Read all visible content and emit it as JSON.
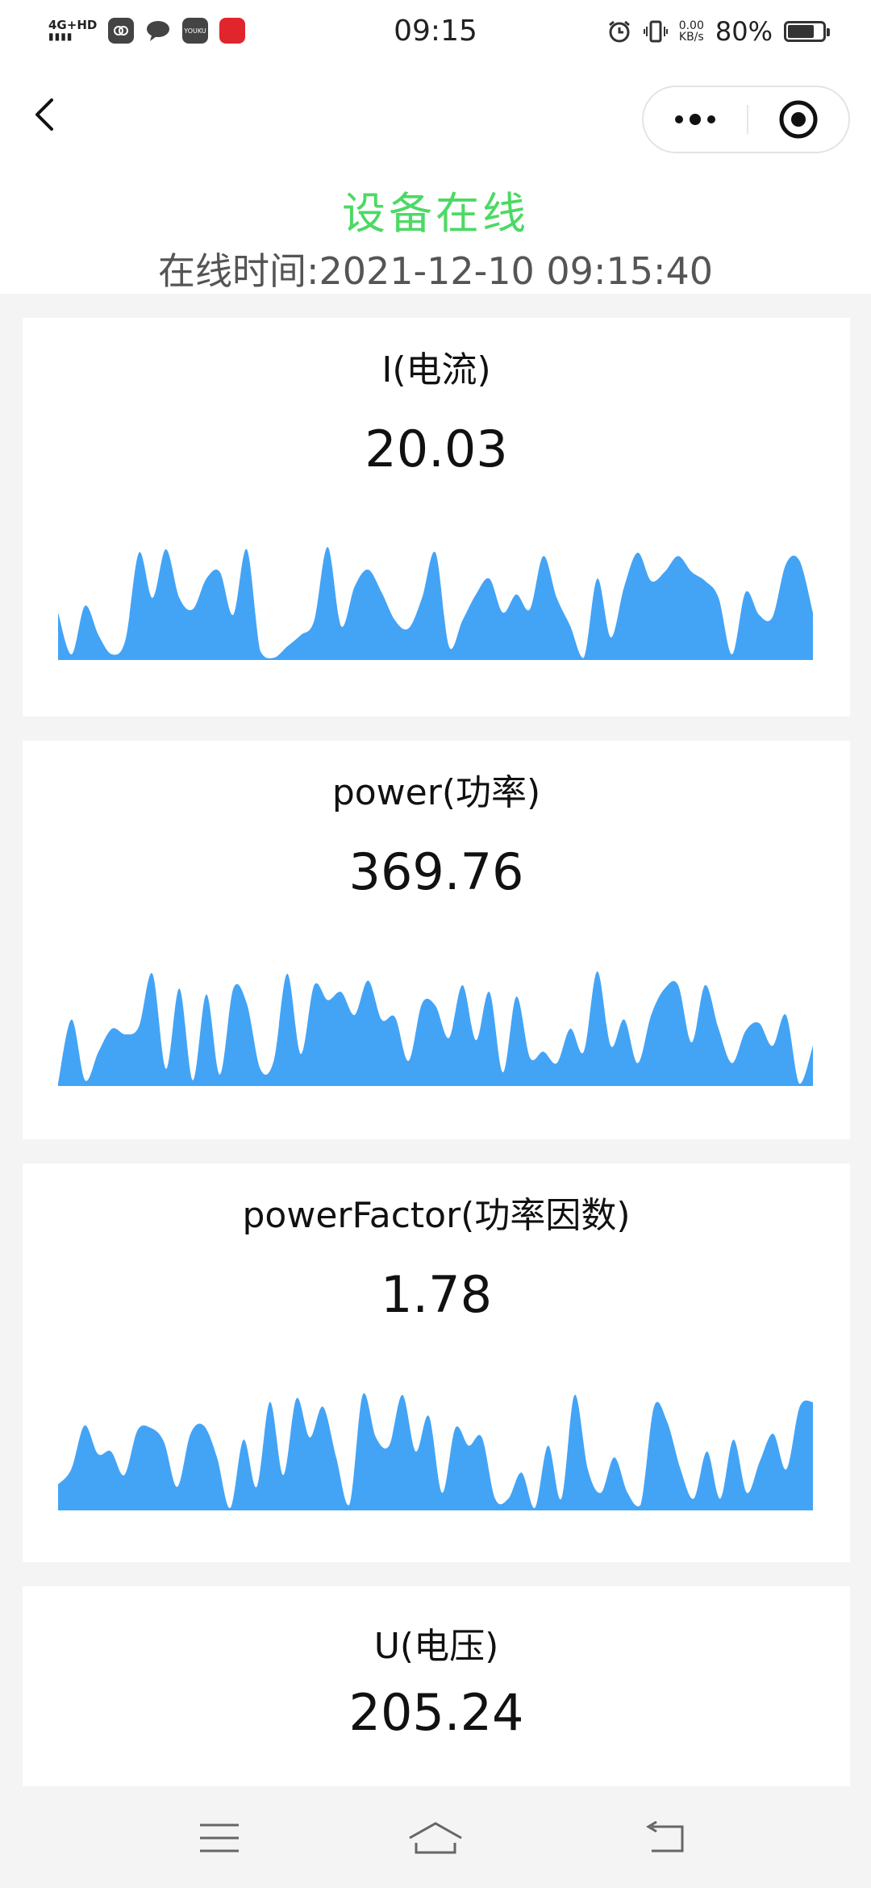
{
  "status_bar": {
    "network": "4G+HD",
    "time": "09:15",
    "net_speed_value": "0.00",
    "net_speed_unit": "KB/s",
    "battery": "80%",
    "battery_level": 0.8,
    "app_icons": [
      "cloud-app-icon",
      "chat-bubble-icon",
      "youku-app-icon",
      "red-app-icon"
    ],
    "youku_label": "YOUKU"
  },
  "header": {
    "status": "设备在线",
    "online_time": "在线时间:2021-12-10 09:15:40"
  },
  "colors": {
    "online_green": "#4cd964",
    "chart_blue": "#43a4f6"
  },
  "cards": [
    {
      "title": "I(电流)",
      "value": "20.03",
      "chart_data": {
        "type": "area",
        "values": [
          0.42,
          0.05,
          0.48,
          0.22,
          0.05,
          0.18,
          0.95,
          0.55,
          0.98,
          0.55,
          0.45,
          0.72,
          0.78,
          0.4,
          0.98,
          0.08,
          0.02,
          0.12,
          0.22,
          0.35,
          1.0,
          0.3,
          0.65,
          0.8,
          0.6,
          0.35,
          0.28,
          0.55,
          0.95,
          0.12,
          0.35,
          0.58,
          0.72,
          0.42,
          0.58,
          0.45,
          0.92,
          0.55,
          0.3,
          0.02,
          0.72,
          0.2,
          0.65,
          0.95,
          0.7,
          0.78,
          0.92,
          0.78,
          0.7,
          0.55,
          0.05,
          0.6,
          0.4,
          0.38,
          0.85,
          0.88,
          0.42
        ]
      }
    },
    {
      "title": "power(功率)",
      "value": "369.76",
      "chart_data": {
        "type": "area",
        "values": [
          0.02,
          0.58,
          0.05,
          0.3,
          0.5,
          0.45,
          0.52,
          0.98,
          0.15,
          0.85,
          0.05,
          0.8,
          0.1,
          0.85,
          0.72,
          0.15,
          0.22,
          0.98,
          0.28,
          0.88,
          0.75,
          0.82,
          0.62,
          0.92,
          0.58,
          0.6,
          0.22,
          0.72,
          0.7,
          0.42,
          0.88,
          0.4,
          0.82,
          0.12,
          0.78,
          0.25,
          0.3,
          0.2,
          0.5,
          0.3,
          1.0,
          0.35,
          0.58,
          0.2,
          0.62,
          0.85,
          0.88,
          0.38,
          0.88,
          0.5,
          0.2,
          0.48,
          0.55,
          0.35,
          0.62,
          0.02,
          0.35
        ]
      }
    },
    {
      "title": "powerFactor(功率因数)",
      "value": "1.78",
      "chart_data": {
        "type": "area",
        "values": [
          0.22,
          0.35,
          0.72,
          0.48,
          0.5,
          0.3,
          0.68,
          0.7,
          0.58,
          0.2,
          0.65,
          0.72,
          0.45,
          0.02,
          0.6,
          0.2,
          0.92,
          0.3,
          0.95,
          0.62,
          0.88,
          0.45,
          0.05,
          0.98,
          0.62,
          0.55,
          0.98,
          0.5,
          0.8,
          0.15,
          0.7,
          0.55,
          0.62,
          0.1,
          0.1,
          0.32,
          0.02,
          0.55,
          0.1,
          0.98,
          0.35,
          0.15,
          0.45,
          0.15,
          0.05,
          0.88,
          0.75,
          0.35,
          0.1,
          0.5,
          0.1,
          0.6,
          0.15,
          0.42,
          0.65,
          0.35,
          0.88,
          0.92
        ]
      }
    },
    {
      "title": "U(电压)",
      "value": "205.24"
    }
  ]
}
